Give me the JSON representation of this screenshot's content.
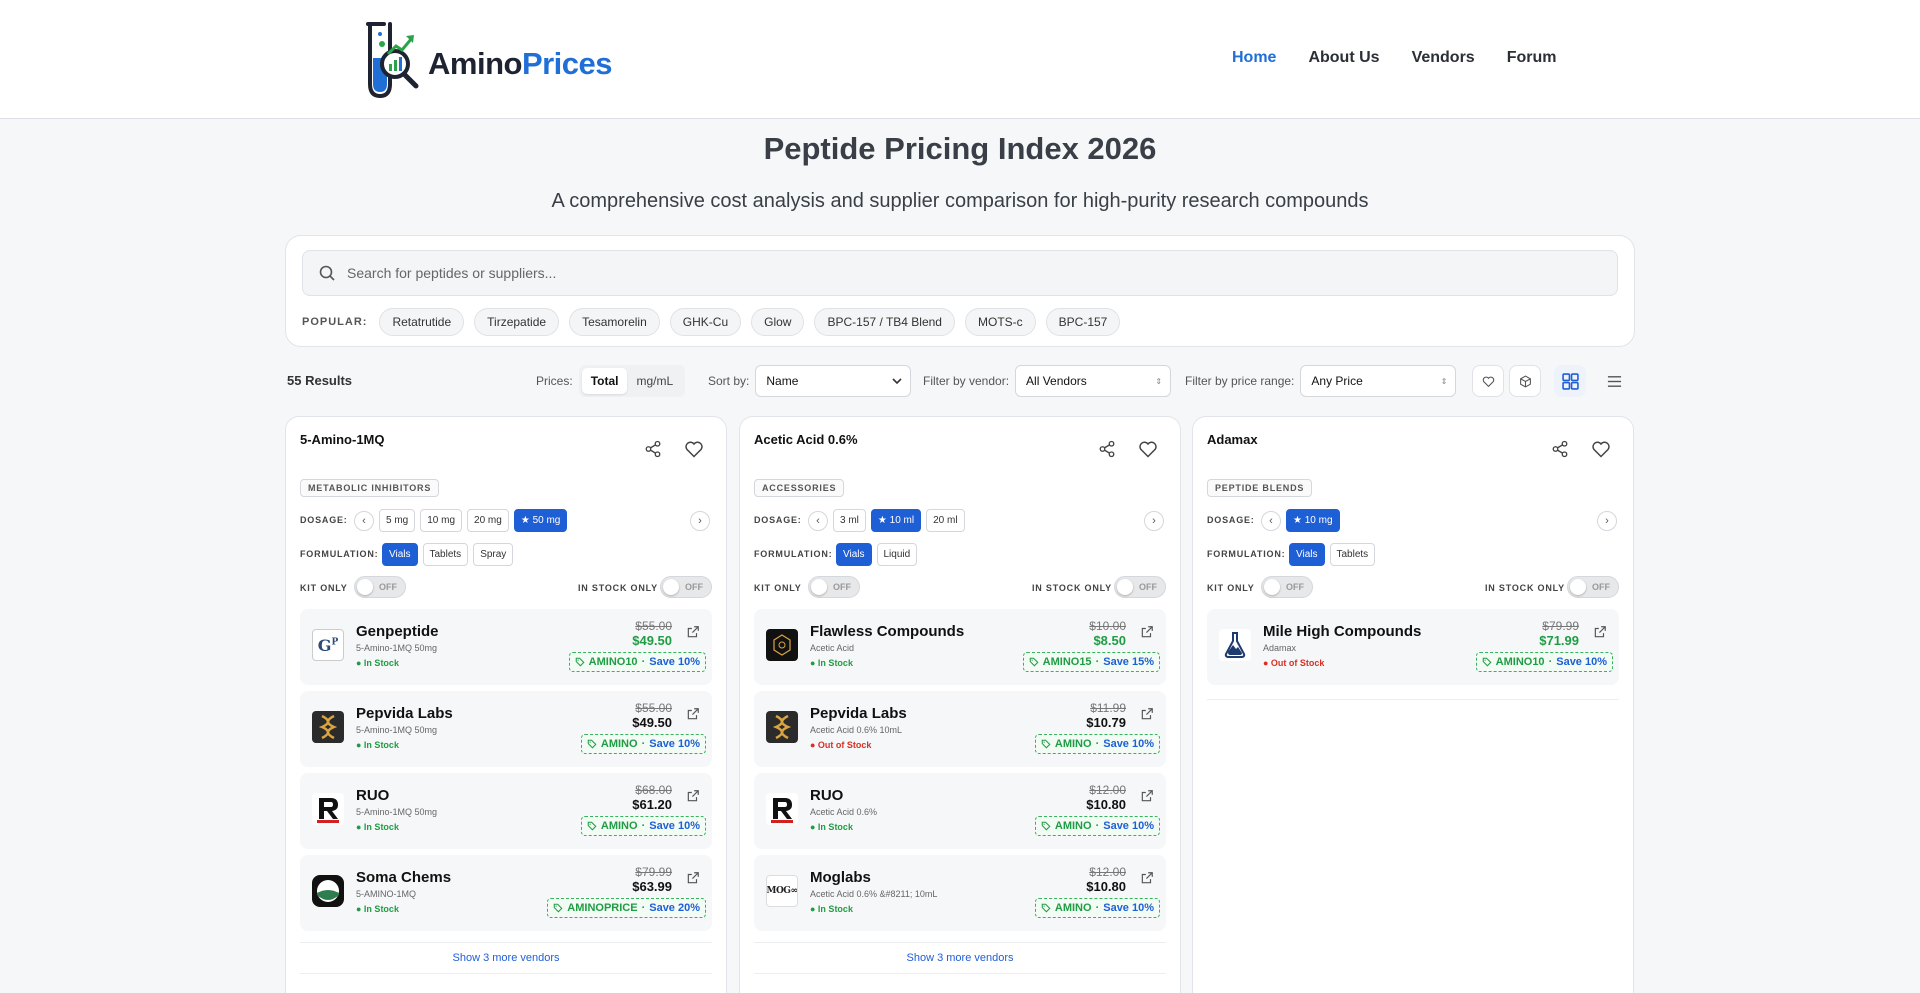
{
  "brand": {
    "name_a": "Amino",
    "name_b": "Prices"
  },
  "nav": {
    "items": [
      "Home",
      "About Us",
      "Vendors",
      "Forum"
    ],
    "active": "Home"
  },
  "hero": {
    "title": "Peptide Pricing Index 2026",
    "subtitle": "A comprehensive cost analysis and supplier comparison for high-purity research compounds"
  },
  "search": {
    "placeholder": "Search for peptides or suppliers...",
    "popular_label": "POPULAR:",
    "popular": [
      "Retatrutide",
      "Tirzepatide",
      "Tesamorelin",
      "GHK-Cu",
      "Glow",
      "BPC-157 / TB4 Blend",
      "MOTS-c",
      "BPC-157"
    ]
  },
  "toolbar": {
    "results": "55 Results",
    "prices_label": "Prices:",
    "prices_options": [
      "Total",
      "mg/mL"
    ],
    "sort_label": "Sort by:",
    "sort_value": "Name",
    "vendor_label": "Filter by vendor:",
    "vendor_value": "All Vendors",
    "price_label": "Filter by price range:",
    "price_value": "Any Price"
  },
  "labels": {
    "dosage": "DOSAGE:",
    "formulation": "FORMULATION:",
    "kit_only": "KIT ONLY",
    "in_stock_only": "IN STOCK ONLY",
    "off": "OFF",
    "in_stock": "● In Stock",
    "out_of_stock": "● Out of Stock"
  },
  "cards": [
    {
      "name": "5-Amino-1MQ",
      "category": "METABOLIC INHIBITORS",
      "dosages": [
        "5 mg",
        "10 mg",
        "20 mg",
        "★ 50 mg"
      ],
      "dosage_selected": 3,
      "formulations": [
        "Vials",
        "Tablets",
        "Spray"
      ],
      "formulation_selected": 0,
      "vendors": [
        {
          "name": "Genpeptide",
          "sub": "5-Amino-1MQ 50mg",
          "stock": "in",
          "old": "$55.00",
          "price": "$49.50",
          "discounted": true,
          "code": "AMINO10",
          "save": "Save 10%"
        },
        {
          "name": "Pepvida Labs",
          "sub": "5-Amino-1MQ 50mg",
          "stock": "in",
          "old": "$55.00",
          "price": "$49.50",
          "discounted": false,
          "code": "AMINO",
          "save": "Save 10%"
        },
        {
          "name": "RUO",
          "sub": "5-Amino-1MQ 50mg",
          "stock": "in",
          "old": "$68.00",
          "price": "$61.20",
          "discounted": false,
          "code": "AMINO",
          "save": "Save 10%"
        },
        {
          "name": "Soma Chems",
          "sub": "5-AMINO-1MQ",
          "stock": "in",
          "old": "$79.99",
          "price": "$63.99",
          "discounted": false,
          "code": "AMINOPRICE",
          "save": "Save 20%"
        }
      ],
      "more": "Show 3 more vendors"
    },
    {
      "name": "Acetic Acid 0.6%",
      "category": "ACCESSORIES",
      "dosages": [
        "3 ml",
        "★ 10 ml",
        "20 ml"
      ],
      "dosage_selected": 1,
      "formulations": [
        "Vials",
        "Liquid"
      ],
      "formulation_selected": 0,
      "vendors": [
        {
          "name": "Flawless Compounds",
          "sub": "Acetic Acid",
          "stock": "in",
          "old": "$10.00",
          "price": "$8.50",
          "discounted": true,
          "code": "AMINO15",
          "save": "Save 15%"
        },
        {
          "name": "Pepvida Labs",
          "sub": "Acetic Acid 0.6% 10mL",
          "stock": "out",
          "old": "$11.99",
          "price": "$10.79",
          "discounted": false,
          "code": "AMINO",
          "save": "Save 10%"
        },
        {
          "name": "RUO",
          "sub": "Acetic Acid 0.6%",
          "stock": "in",
          "old": "$12.00",
          "price": "$10.80",
          "discounted": false,
          "code": "AMINO",
          "save": "Save 10%"
        },
        {
          "name": "Moglabs",
          "sub": "Acetic Acid 0.6% &#8211; 10mL",
          "stock": "in",
          "old": "$12.00",
          "price": "$10.80",
          "discounted": false,
          "code": "AMINO",
          "save": "Save 10%"
        }
      ],
      "more": "Show 3 more vendors"
    },
    {
      "name": "Adamax",
      "category": "PEPTIDE BLENDS",
      "dosages": [
        "★ 10 mg"
      ],
      "dosage_selected": 0,
      "formulations": [
        "Vials",
        "Tablets"
      ],
      "formulation_selected": 0,
      "vendors": [
        {
          "name": "Mile High Compounds",
          "sub": "Adamax",
          "stock": "out",
          "old": "$79.99",
          "price": "$71.99",
          "discounted": true,
          "code": "AMINO10",
          "save": "Save 10%"
        }
      ],
      "more": ""
    }
  ]
}
